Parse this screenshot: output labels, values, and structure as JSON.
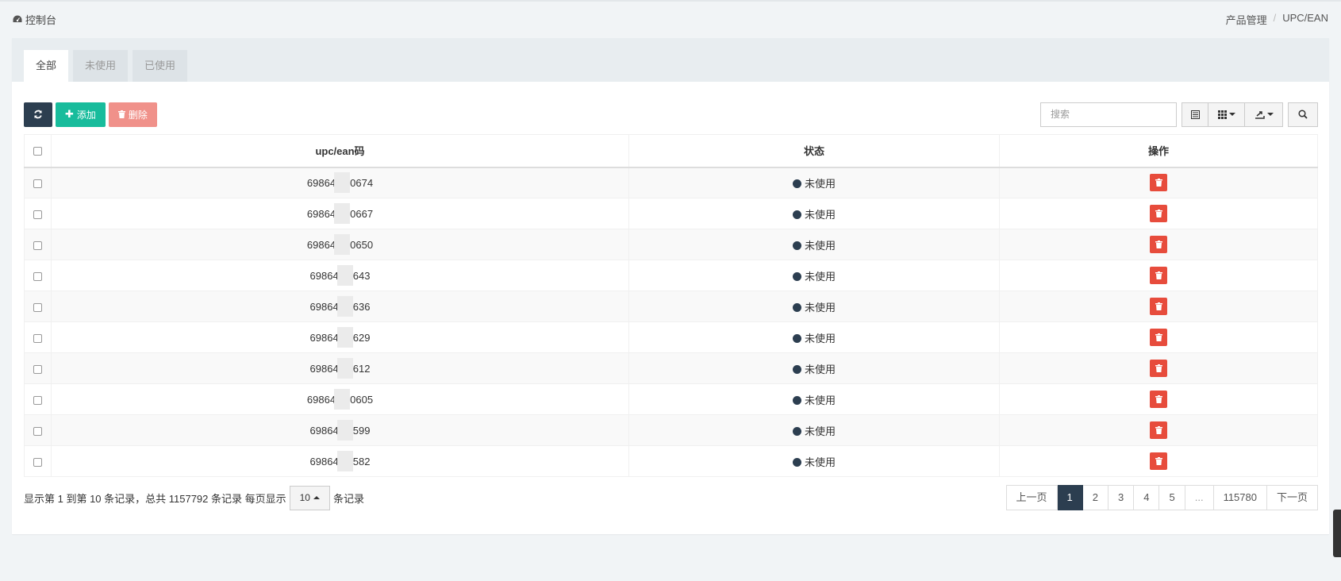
{
  "header": {
    "dashboard_label": "控制台",
    "breadcrumb": [
      "产品管理",
      "UPC/EAN"
    ],
    "breadcrumb_sep": "/"
  },
  "tabs": [
    {
      "label": "全部",
      "active": true
    },
    {
      "label": "未使用",
      "active": false
    },
    {
      "label": "已使用",
      "active": false
    }
  ],
  "toolbar": {
    "add_label": "添加",
    "delete_label": "删除",
    "search_placeholder": "搜索",
    "colors": {
      "dark": "#2c3e50",
      "green": "#18bc9c",
      "red": "#f0918a"
    }
  },
  "table": {
    "columns": [
      "upc/ean码",
      "状态",
      "操作"
    ],
    "rows": [
      {
        "code": "69864  810674",
        "status": "未使用"
      },
      {
        "code": "69864  810667",
        "status": "未使用"
      },
      {
        "code": "69864  810650",
        "status": "未使用"
      },
      {
        "code": "69864  10643",
        "status": "未使用"
      },
      {
        "code": "69864  10636",
        "status": "未使用"
      },
      {
        "code": "69864  10629",
        "status": "未使用"
      },
      {
        "code": "69864  10612",
        "status": "未使用"
      },
      {
        "code": "698641  10605",
        "status": "未使用"
      },
      {
        "code": "698641  0599",
        "status": "未使用"
      },
      {
        "code": "698641  0582",
        "status": "未使用"
      }
    ]
  },
  "pagination": {
    "info_prefix": "显示第 1 到第 10 条记录，总共 1157792 条记录 每页显示",
    "page_size": "10",
    "info_suffix": "条记录",
    "prev": "上一页",
    "pages": [
      "1",
      "2",
      "3",
      "4",
      "5",
      "...",
      "115780"
    ],
    "next": "下一页",
    "current": "1"
  }
}
